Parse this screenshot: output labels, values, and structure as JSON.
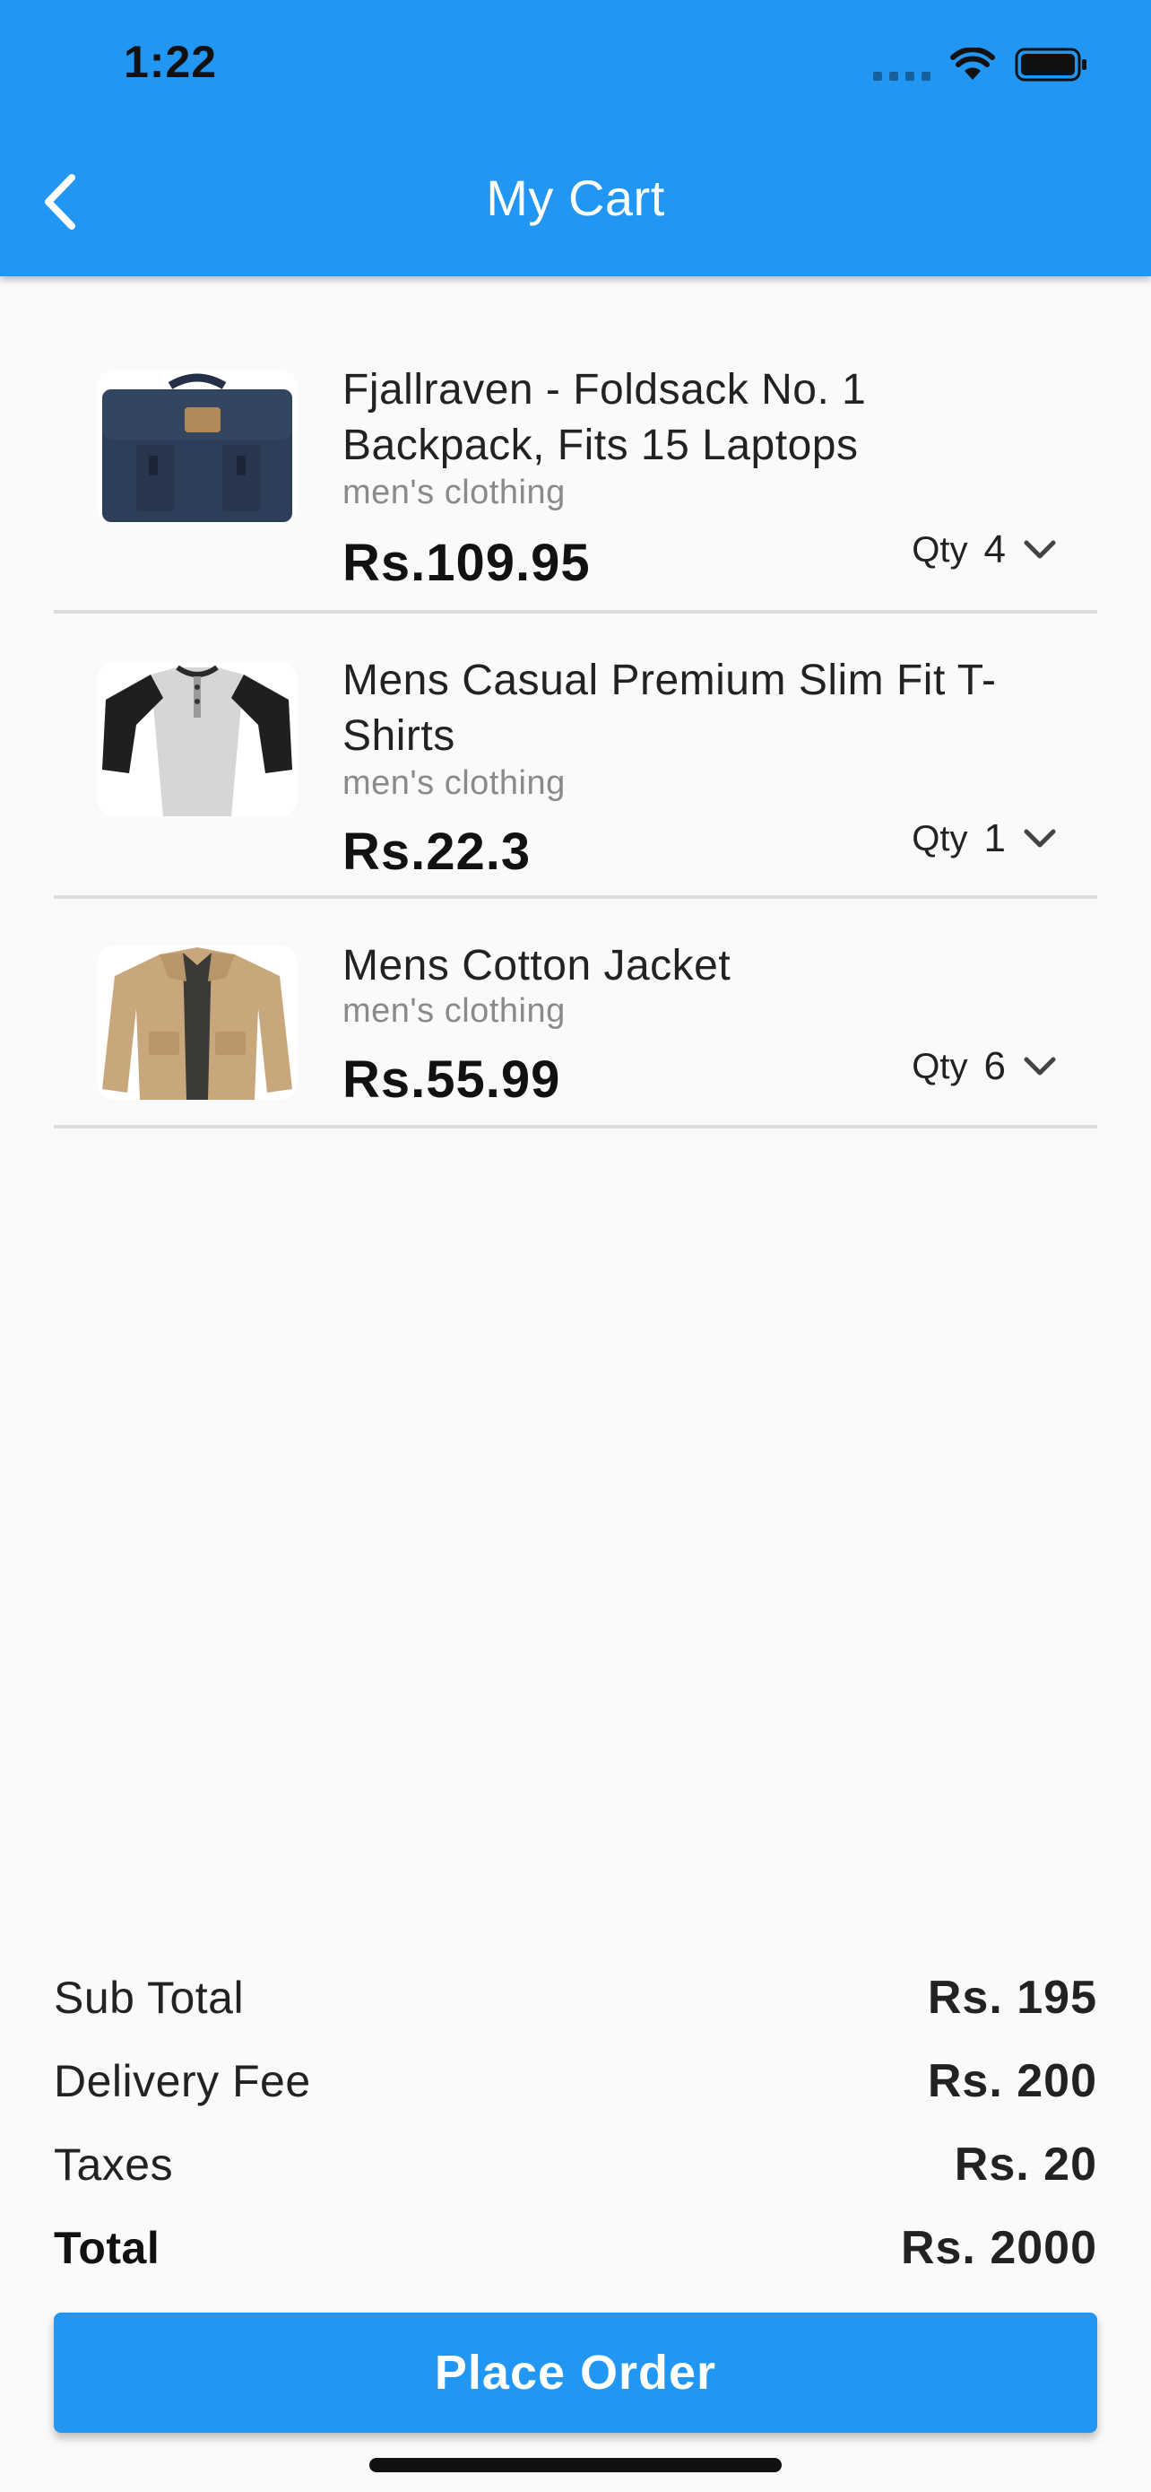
{
  "status_bar": {
    "time": "1:22"
  },
  "header": {
    "title": "My Cart",
    "back_icon": "chevron-left-icon"
  },
  "cart": {
    "items": [
      {
        "title": "Fjallraven - Foldsack No. 1 Backpack, Fits 15 Laptops",
        "category": "men's clothing",
        "price": "Rs.109.95",
        "qty_label": "Qty",
        "qty": "4",
        "image": "navy-backpack-image"
      },
      {
        "title": "Mens Casual Premium Slim Fit T-Shirts",
        "category": "men's clothing",
        "price": "Rs.22.3",
        "qty_label": "Qty",
        "qty": "1",
        "image": "raglan-tshirt-image"
      },
      {
        "title": "Mens Cotton Jacket",
        "category": "men's clothing",
        "price": "Rs.55.99",
        "qty_label": "Qty",
        "qty": "6",
        "image": "khaki-jacket-image"
      }
    ]
  },
  "summary": {
    "rows": [
      {
        "label": "Sub Total",
        "value": "Rs. 195"
      },
      {
        "label": "Delivery Fee",
        "value": "Rs. 200"
      },
      {
        "label": "Taxes",
        "value": "Rs. 20"
      },
      {
        "label": "Total",
        "value": "Rs. 2000"
      }
    ]
  },
  "actions": {
    "place_order_label": "Place Order"
  },
  "colors": {
    "primary": "#2196f3",
    "background": "#fafafa",
    "divider": "#dcdcdc"
  }
}
